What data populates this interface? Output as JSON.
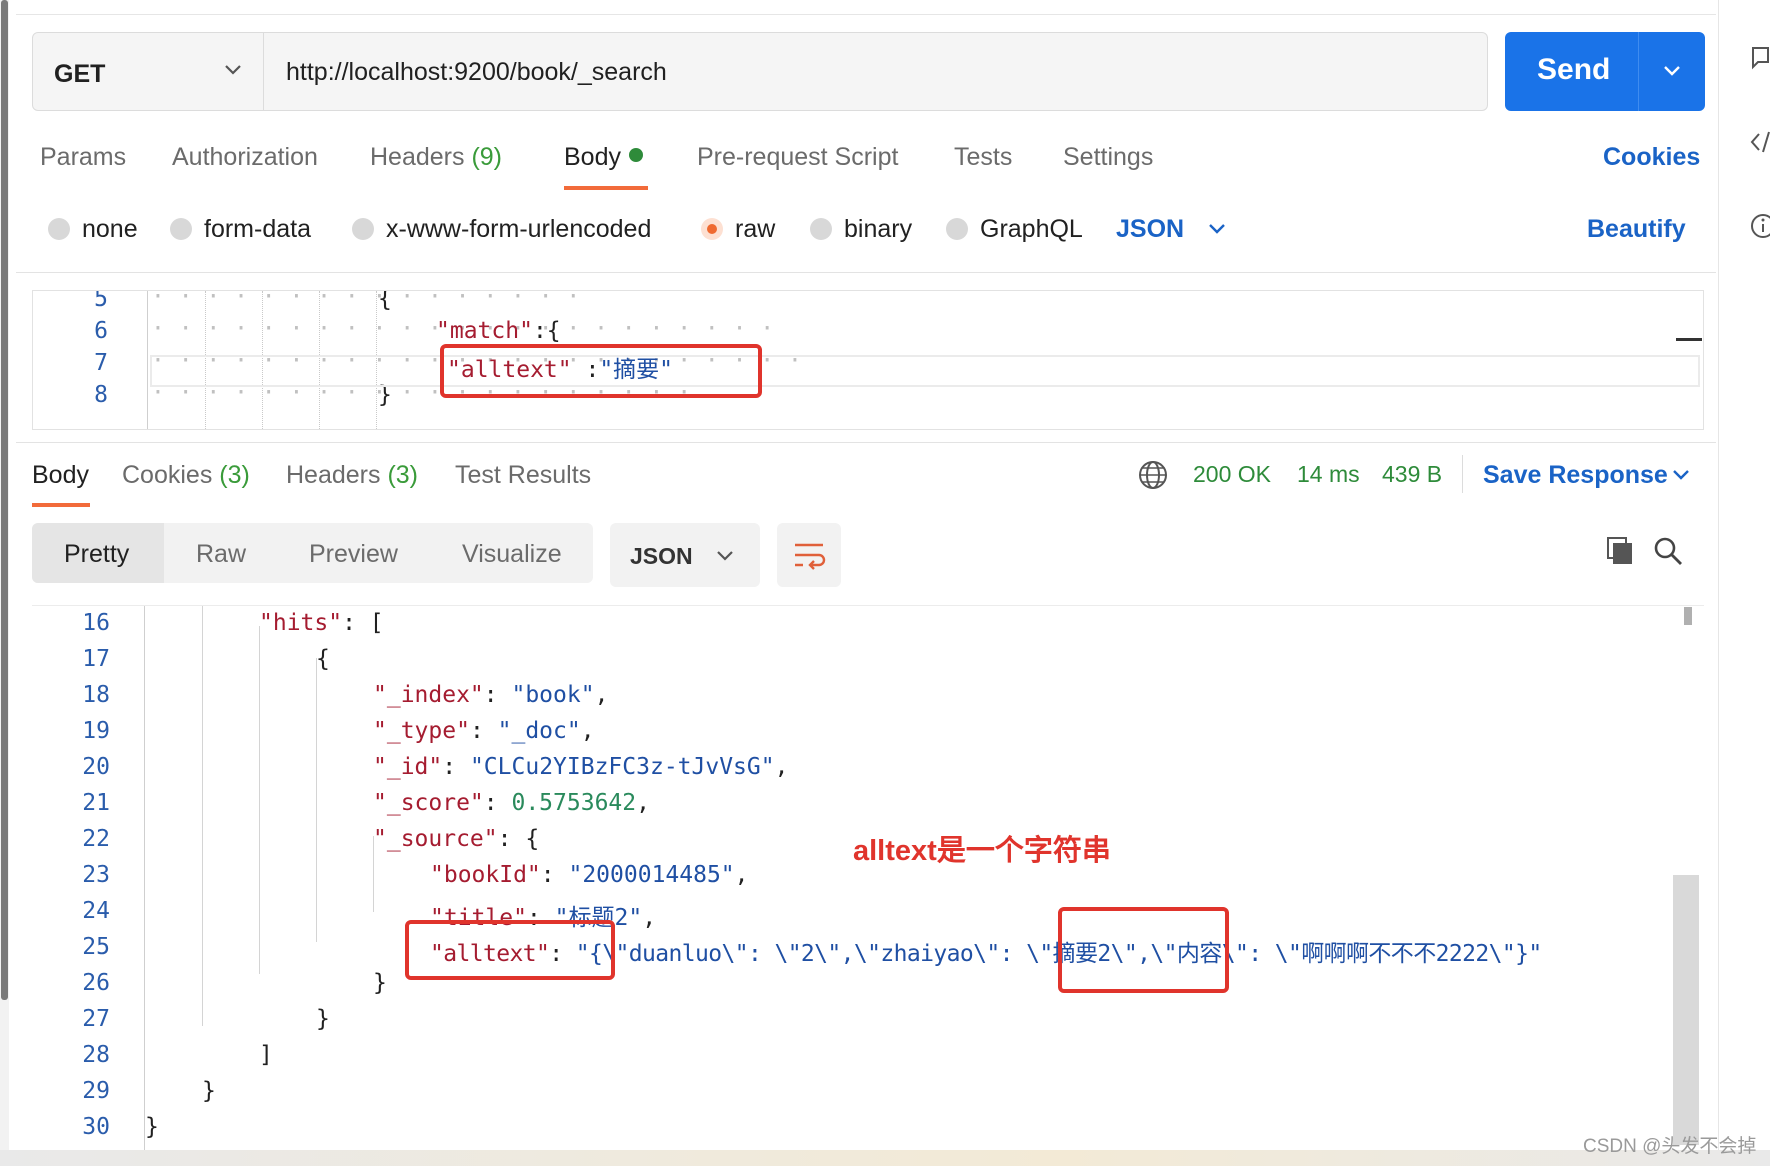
{
  "request": {
    "method": "GET",
    "url": "http://localhost:9200/book/_search",
    "send_label": "Send"
  },
  "request_tabs": [
    {
      "label": "Params"
    },
    {
      "label": "Authorization"
    },
    {
      "label": "Headers",
      "count": "(9)"
    },
    {
      "label": "Body"
    },
    {
      "label": "Pre-request Script"
    },
    {
      "label": "Tests"
    },
    {
      "label": "Settings"
    }
  ],
  "cookies_label": "Cookies",
  "body_options": [
    "none",
    "form-data",
    "x-www-form-urlencoded",
    "raw",
    "binary",
    "GraphQL"
  ],
  "body_selected": "raw",
  "body_format": "JSON",
  "beautify_label": "Beautify",
  "request_editor": {
    "line_numbers": [
      "5",
      "6",
      "7",
      "8"
    ],
    "lines": [
      {
        "open": "{"
      },
      {
        "key": "\"match\"",
        "sep": ":",
        "open": "{"
      },
      {
        "key": "\"alltext\"",
        "sep": " :",
        "value": "\"摘要\""
      },
      {
        "close": "}"
      }
    ]
  },
  "response_tabs": [
    {
      "label": "Body"
    },
    {
      "label": "Cookies",
      "count": "(3)"
    },
    {
      "label": "Headers",
      "count": "(3)"
    },
    {
      "label": "Test Results"
    }
  ],
  "response_status": {
    "code": "200 OK",
    "time": "14 ms",
    "size": "439 B"
  },
  "save_response_label": "Save Response",
  "view_modes": [
    "Pretty",
    "Raw",
    "Preview",
    "Visualize"
  ],
  "view_mode_selected": "Pretty",
  "response_format": "JSON",
  "response_editor": {
    "line_numbers": [
      "16",
      "17",
      "18",
      "19",
      "20",
      "21",
      "22",
      "23",
      "24",
      "25",
      "26",
      "27",
      "28",
      "29",
      "30"
    ],
    "lines": [
      {
        "key": "\"hits\"",
        "sep": ": ",
        "open": "["
      },
      {
        "open": "{"
      },
      {
        "key": "\"_index\"",
        "sep": ": ",
        "value": "\"book\"",
        "end": ","
      },
      {
        "key": "\"_type\"",
        "sep": ": ",
        "value": "\"_doc\"",
        "end": ","
      },
      {
        "key": "\"_id\"",
        "sep": ": ",
        "value": "\"CLCu2YIBzFC3z-tJvVsG\"",
        "end": ","
      },
      {
        "key": "\"_score\"",
        "sep": ": ",
        "number": "0.5753642",
        "end": ","
      },
      {
        "key": "\"_source\"",
        "sep": ": ",
        "open": "{"
      },
      {
        "key": "\"bookId\"",
        "sep": ": ",
        "value": "\"2000014485\"",
        "end": ","
      },
      {
        "key": "\"title\"",
        "sep": ": ",
        "value": "\"标题2\"",
        "end": ","
      },
      {
        "key": "\"alltext\"",
        "sep": ": ",
        "value": "\"{\\\"duanluo\\\": \\\"2\\\",\\\"zhaiyao\\\": \\\"摘要2\\\",\\\"内容\\\": \\\"啊啊啊不不不2222\\\"}\""
      },
      {
        "close": "}"
      },
      {
        "close": "}"
      },
      {
        "close": "]"
      },
      {
        "close": "}"
      },
      {
        "close": "}"
      }
    ]
  },
  "annotation_text": "alltext是一个字符串",
  "watermark": "CSDN @头发不会掉",
  "colors": {
    "accent": "#1a73e8",
    "status_ok": "#2e8b3a",
    "annotation": "#e0342c",
    "tab_indicator": "#f26b3a"
  }
}
